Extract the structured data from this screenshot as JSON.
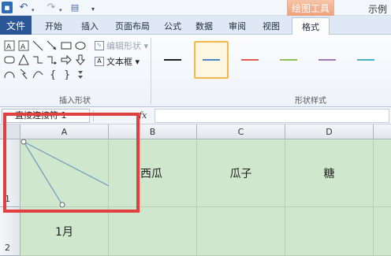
{
  "titlebar": {
    "context_tab_header": "绘图工具",
    "window_title": "示例"
  },
  "tabs": [
    "文件",
    "开始",
    "插入",
    "页面布局",
    "公式",
    "数据",
    "审阅",
    "视图",
    "格式"
  ],
  "ribbon": {
    "insert_shapes": {
      "label": "插入形状",
      "edit_shape": "编辑形状 ▾",
      "text_box": "文本框 ▾"
    },
    "shape_styles": {
      "label": "形状样式",
      "swatch_colors": [
        "#1f1f1f",
        "#4a86c5",
        "#e05a57",
        "#8fbf5a",
        "#9b7bb5",
        "#4bb3c8"
      ],
      "selected_index": 1
    }
  },
  "formula_bar": {
    "name_box": "直接连接符 1",
    "fx": "fx",
    "value": ""
  },
  "sheet": {
    "columns": [
      "A",
      "B",
      "C",
      "D"
    ],
    "rows": [
      "1",
      "2"
    ],
    "cells": {
      "A1": "",
      "B1": "西瓜",
      "C1": "瓜子",
      "D1": "糖",
      "A2": "1月",
      "B2": "",
      "C2": "",
      "D2": ""
    },
    "selection_color": "#e0403f",
    "shape_line_color": "#6f9ac2"
  }
}
